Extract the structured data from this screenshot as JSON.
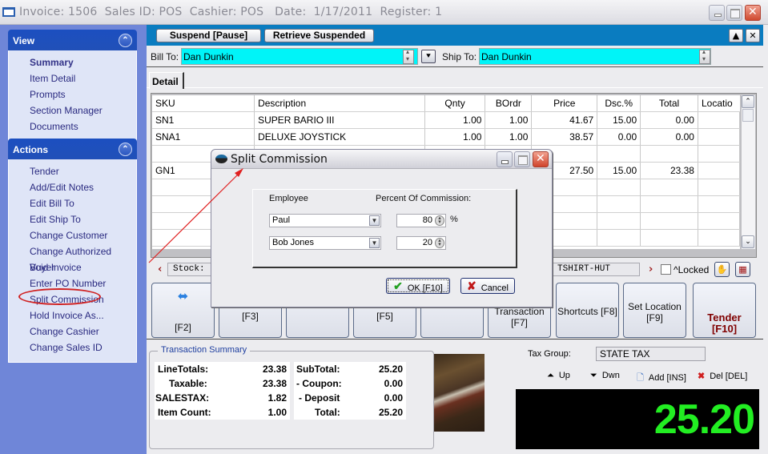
{
  "window": {
    "title": "Invoice: 1506  Sales ID: POS  Cashier: POS   Date:  1/17/2011  Register: 1"
  },
  "sidebar": {
    "view": {
      "header": "View",
      "items": [
        {
          "label": "Summary",
          "active": true
        },
        {
          "label": "Item Detail"
        },
        {
          "label": "Prompts"
        },
        {
          "label": "Section Manager"
        },
        {
          "label": "Documents"
        }
      ]
    },
    "actions": {
      "header": "Actions",
      "items": [
        {
          "label": "Tender"
        },
        {
          "label": "Add/Edit Notes"
        },
        {
          "label": "Edit Bill To"
        },
        {
          "label": "Edit Ship To"
        },
        {
          "label": "Change Customer"
        },
        {
          "label": "Change Authorized Buyer"
        },
        {
          "label": "Void Invoice"
        },
        {
          "label": "Enter PO Number"
        },
        {
          "label": "Split Commission",
          "highlighted": true
        },
        {
          "label": "Hold Invoice As..."
        },
        {
          "label": "Change Cashier"
        },
        {
          "label": "Change Sales ID"
        }
      ]
    }
  },
  "toolbar": {
    "suspend_label": "Suspend [Pause]",
    "retrieve_label": "Retrieve Suspended"
  },
  "customer": {
    "bill_to_label": "Bill To:",
    "bill_to_value": "Dan Dunkin",
    "ship_to_label": "Ship To:",
    "ship_to_value": "Dan Dunkin"
  },
  "tabs": [
    {
      "label": "Detail",
      "active": true
    }
  ],
  "grid": {
    "columns": [
      "SKU",
      "Description",
      "Qnty",
      "BOrdr",
      "Price",
      "Dsc.%",
      "Total",
      "Locatio"
    ],
    "rows": [
      [
        "SN1",
        "SUPER BARIO III",
        "1.00",
        "1.00",
        "41.67",
        "15.00",
        "0.00",
        ""
      ],
      [
        "SNA1",
        "DELUXE JOYSTICK",
        "1.00",
        "1.00",
        "38.57",
        "0.00",
        "0.00",
        ""
      ],
      [
        "",
        "",
        "",
        "",
        "",
        "",
        "",
        ""
      ],
      [
        "GN1",
        "",
        "",
        "",
        "27.50",
        "15.00",
        "23.38",
        ""
      ]
    ]
  },
  "stock": {
    "label": "Stock:",
    "location": "TSHIRT-HUT",
    "locked_label": "^Locked",
    "locked": false
  },
  "function_keys": [
    {
      "label": "[F2]",
      "icon": "left-right-arrows-icon"
    },
    {
      "label": "[F3]"
    },
    {
      "label": ""
    },
    {
      "label": "[F5]"
    },
    {
      "label": ""
    },
    {
      "label": "Transaction [F7]"
    },
    {
      "label": "Shortcuts [F8]"
    },
    {
      "label": "Set Location\n[F9]"
    },
    {
      "label": "Tender\n[F10]"
    }
  ],
  "summary": {
    "legend": "Transaction Summary",
    "left": [
      {
        "label": "LineTotals:",
        "value": "23.38"
      },
      {
        "label": "Taxable:",
        "value": "23.38"
      },
      {
        "label": "SALESTAX:",
        "value": "1.82"
      },
      {
        "label": "Item Count:",
        "value": "1.00"
      }
    ],
    "right": [
      {
        "label": "SubTotal:",
        "value": "25.20"
      },
      {
        "label": "- Coupon:",
        "value": "0.00"
      },
      {
        "label": "- Deposit",
        "value": "0.00"
      },
      {
        "label": "Total:",
        "value": "25.20"
      }
    ]
  },
  "tax": {
    "label": "Tax Group:",
    "value": "STATE TAX"
  },
  "nav_buttons": [
    {
      "label": "Up",
      "icon": "move-up-icon"
    },
    {
      "label": "Dwn",
      "icon": "move-down-icon"
    },
    {
      "label": "Add [INS]",
      "icon": "new-document-icon"
    },
    {
      "label": "Del [DEL]",
      "icon": "delete-icon"
    }
  ],
  "total_display": "25.20",
  "dialog": {
    "title": "Split Commission",
    "employee_header": "Employee",
    "percent_header": "Percent Of Commission:",
    "rows": [
      {
        "employee": "Paul",
        "percent": "80"
      },
      {
        "employee": "Bob Jones",
        "percent": "20"
      }
    ],
    "percent_sign": "%",
    "ok_label": "OK [F10]",
    "cancel_label": "Cancel"
  },
  "colors": {
    "toolbar_blue": "#0a7cc0",
    "sidebar_bg": "#6f86d8",
    "customer_field": "#00f4f8",
    "total_green": "#22ee22",
    "annotation_red": "#d02020"
  }
}
